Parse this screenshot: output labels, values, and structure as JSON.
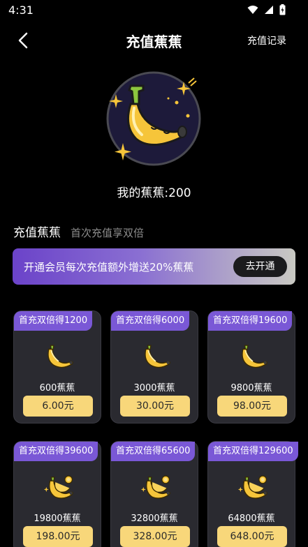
{
  "status": {
    "time": "4:31"
  },
  "nav": {
    "title": "充值蕉蕉",
    "record": "充值记录"
  },
  "balance": {
    "text": "我的蕉蕉:200"
  },
  "section": {
    "title": "充值蕉蕉",
    "subtitle": "首次充值享双倍"
  },
  "vip": {
    "text": "开通会员每次充值额外增送20%蕉蕉",
    "button": "去开通"
  },
  "packages": [
    {
      "badge": "首充双倍得1200",
      "amount": "600蕉蕉",
      "price": "6.00元",
      "icon": "single-banana-icon"
    },
    {
      "badge": "首充双倍得6000",
      "amount": "3000蕉蕉",
      "price": "30.00元",
      "icon": "single-banana-icon"
    },
    {
      "badge": "首充双倍得19600",
      "amount": "9800蕉蕉",
      "price": "98.00元",
      "icon": "single-banana-icon"
    },
    {
      "badge": "首充双倍得39600",
      "amount": "19800蕉蕉",
      "price": "198.00元",
      "icon": "banana-bunch-icon"
    },
    {
      "badge": "首充双倍得65600",
      "amount": "32800蕉蕉",
      "price": "328.00元",
      "icon": "banana-bunch-icon"
    },
    {
      "badge": "首充双倍得129600",
      "amount": "64800蕉蕉",
      "price": "648.00元",
      "icon": "banana-bunch-icon"
    }
  ],
  "colors": {
    "background": "#000000",
    "card": "#2a2a30",
    "badge": "#7a58d6",
    "price_button": "#f8d77a",
    "banana": "#f6c53a"
  }
}
